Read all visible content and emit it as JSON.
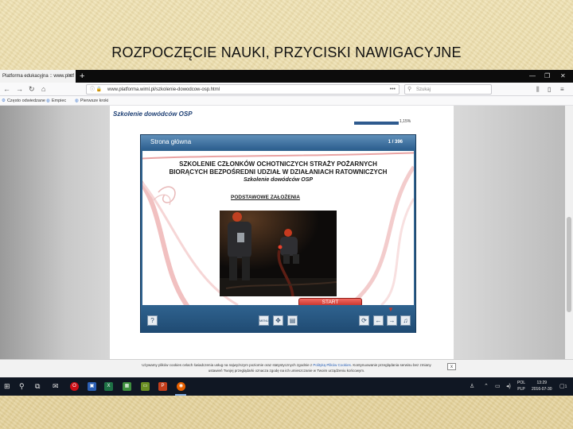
{
  "slide": {
    "title": "ROZPOCZĘCIE NAUKI, PRZYCISKI NAWIGACYJNE"
  },
  "browser": {
    "tab_title": "Platforma edukacyjna :: www.platf",
    "tab_close": "×",
    "new_tab": "+",
    "url": "www.platforma.wiml.pl/szkolenie-dowodcow-osp.html",
    "url_more": "•••",
    "search_placeholder": "Szukaj",
    "bookmarks": [
      "Często odwiedzane",
      "Empiec",
      "Pierwsze kroki"
    ],
    "window_controls": [
      "—",
      "❐",
      "✕"
    ]
  },
  "page": {
    "course_title": "Szkolenie dowódców OSP",
    "progress_label": "1,15%",
    "progress_fraction": 0.0115
  },
  "module": {
    "header_title": "Strona główna",
    "page_indicator": "1 / 396",
    "title_line1": "SZKOLENIE CZŁONKÓW OCHOTNICZYCH STRAŻY POŻARNYCH",
    "title_line2": "BIORĄCYCH BEZPOŚREDNI UDZIAŁ W DZIAŁANIACH RATOWNICZYCH",
    "subtitle": "Szkolenie dowódców OSP",
    "section": "PODSTAWOWE ZAŁOŻENIA",
    "start_label": "START",
    "footer": {
      "help": "?",
      "menu": "MENU",
      "move": "✥",
      "doc": "▤",
      "reload": "⟳",
      "back": "←",
      "forward": "→",
      "sound": "♫"
    }
  },
  "cookie": {
    "text_before": "Używamy plików cookies celach świadczenia usług na najwyższym poziomie oraz statystycznych zgodnie z ",
    "link": "Polityką Plików Cookies",
    "text_after": ". Kontynuowanie przeglądania serwisu bez zmiany ustawień Twojej przeglądarki oznacza zgodę na ich umieszczanie w Twoim urządzeniu końcowym.",
    "close": "x"
  },
  "taskbar": {
    "lang_line1": "POL",
    "lang_line2": "PLP",
    "time": "13:29",
    "date": "2016-07-30",
    "notification_count": "1"
  }
}
